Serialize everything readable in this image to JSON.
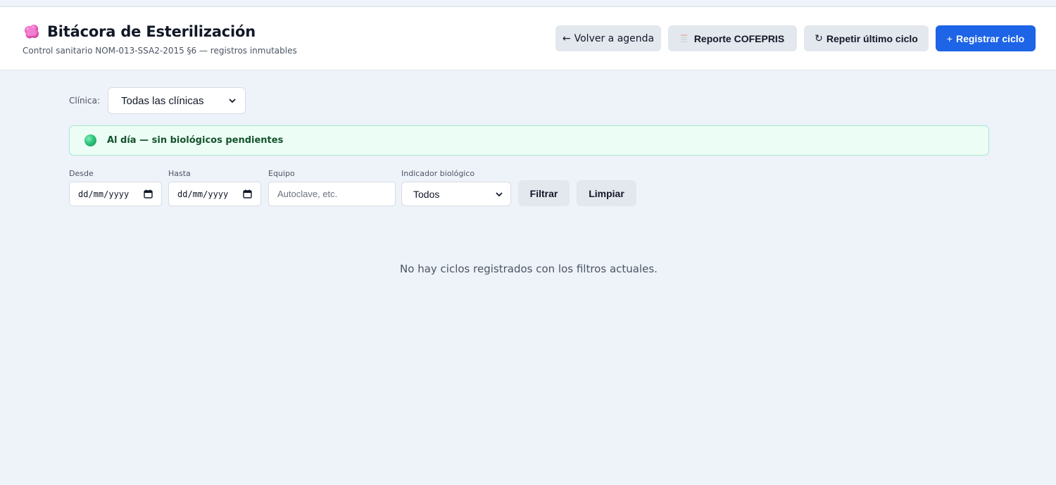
{
  "header": {
    "icon": "pink-sterilization-blob-icon",
    "title": "Bitácora de Esterilización",
    "subtitle": "Control sanitario NOM-013-SSA2-2015 §6 — registros inmutables",
    "actions": {
      "back_label": "Volver a agenda",
      "back_glyph": "←",
      "report_label": "Reporte COFEPRIS",
      "report_icon": "document-icon",
      "repeat_label": "Repetir último ciclo",
      "repeat_glyph": "↻",
      "register_label": "Registrar ciclo",
      "register_glyph": "+"
    }
  },
  "clinic_filter": {
    "label": "Clínica:",
    "selected": "Todas las clínicas"
  },
  "status": {
    "text": "Al día — sin biológicos pendientes",
    "color": "#2fc37b"
  },
  "filters": {
    "from_label": "Desde",
    "from_value": "dd/mm/yyyy",
    "to_label": "Hasta",
    "to_value": "dd/mm/yyyy",
    "equipment_label": "Equipo",
    "equipment_placeholder": "Autoclave, etc.",
    "bio_label": "Indicador biológico",
    "bio_selected": "Todos",
    "filter_button": "Filtrar",
    "clear_button": "Limpiar"
  },
  "empty_state": {
    "message": "No hay ciclos registrados con los filtros actuales."
  },
  "colors": {
    "primary": "#1d64e6",
    "background": "#eef2f9",
    "success_bg": "#ecfdf5"
  }
}
